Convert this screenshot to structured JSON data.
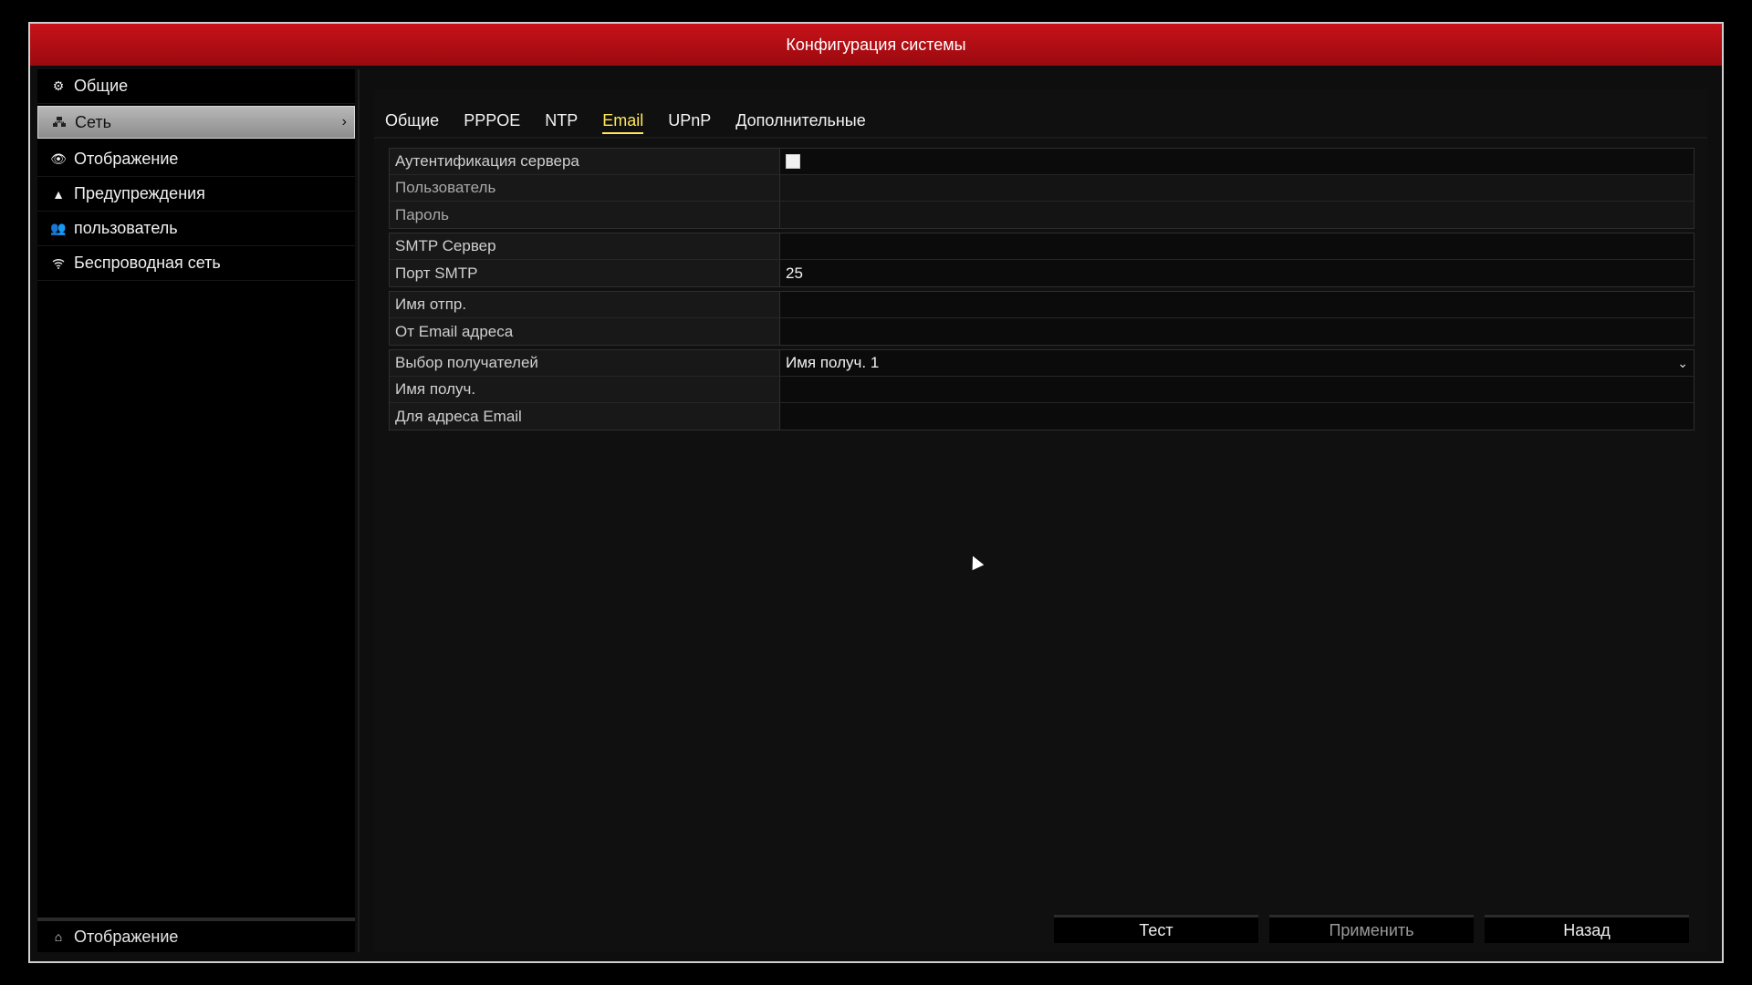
{
  "window": {
    "title": "Конфигурация системы"
  },
  "sidebar": {
    "items": [
      {
        "label": "Общие",
        "icon": "gear-icon"
      },
      {
        "label": "Сеть",
        "icon": "network-icon",
        "active": true
      },
      {
        "label": "Отображение",
        "icon": "eye-icon"
      },
      {
        "label": "Предупреждения",
        "icon": "warning-icon"
      },
      {
        "label": "пользователь",
        "icon": "users-icon"
      },
      {
        "label": "Беспроводная сеть",
        "icon": "wifi-icon"
      }
    ],
    "bottom": {
      "label": "Отображение",
      "icon": "home-icon"
    }
  },
  "tabs": [
    {
      "label": "Общие"
    },
    {
      "label": "PPPOE"
    },
    {
      "label": "NTP"
    },
    {
      "label": "Email",
      "active": true
    },
    {
      "label": "UPnP"
    },
    {
      "label": "Дополнительные"
    }
  ],
  "form": {
    "auth_label": "Аутентификация сервера",
    "user_label": "Пользователь",
    "user_value": "",
    "password_label": "Пароль",
    "password_value": "",
    "smtp_server_label": "SMTP Сервер",
    "smtp_server_value": "",
    "smtp_port_label": "Порт SMTP",
    "smtp_port_value": "25",
    "sender_name_label": "Имя отпр.",
    "sender_name_value": "",
    "from_email_label": "От Email адреса",
    "from_email_value": "",
    "recipient_select_label": "Выбор получателей",
    "recipient_select_value": "Имя получ. 1",
    "recipient_name_label": "Имя получ.",
    "recipient_name_value": "",
    "to_email_label": "Для адреса Email",
    "to_email_value": ""
  },
  "buttons": {
    "test": "Тест",
    "apply": "Применить",
    "back": "Назад"
  },
  "colors": {
    "titlebar": "#b00e14",
    "active_tab": "#ffe65a"
  }
}
